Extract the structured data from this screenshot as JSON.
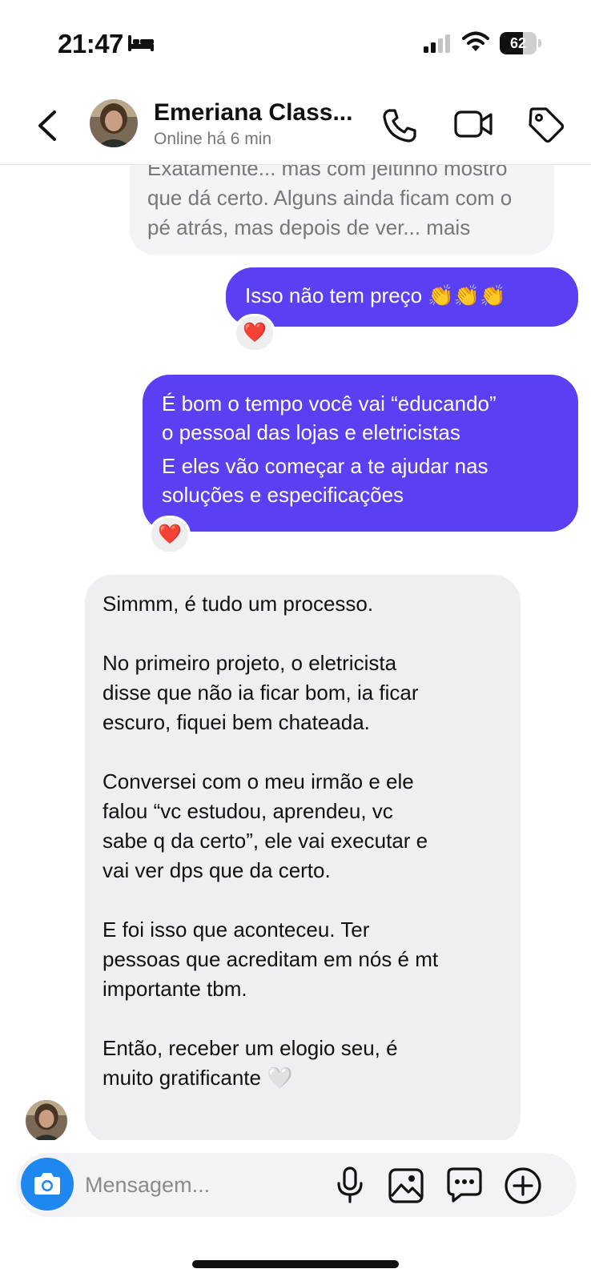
{
  "status_bar": {
    "time": "21:47",
    "battery": "62",
    "battery_level": 0.62,
    "icons": [
      "bed-icon",
      "signal-icon",
      "wifi-icon",
      "battery-icon"
    ]
  },
  "header": {
    "contact_name": "Emeriana Class...",
    "contact_status": "Online há 6 min",
    "icons": [
      "back-icon",
      "phone-icon",
      "video-icon",
      "tag-icon"
    ]
  },
  "messages": [
    {
      "sender": "contact",
      "lines": [
        "Exatamente... mas com jeitinho mostro",
        "que dá certo. Alguns ainda ficam com o",
        "pé atrás, mas depois de ver... mais"
      ]
    },
    {
      "sender": "me",
      "text": "Isso não tem preço 👏👏👏",
      "reaction": "❤️"
    },
    {
      "sender": "me",
      "paragraphs": [
        [
          "É bom o tempo você vai “educando”",
          "o pessoal das lojas e eletricistas"
        ],
        [
          "E eles vão começar a te ajudar nas",
          "soluções e especificações"
        ]
      ],
      "reaction": "❤️"
    },
    {
      "sender": "contact",
      "paragraphs": [
        [
          "Simmm, é tudo um processo."
        ],
        [
          "No primeiro projeto, o eletricista",
          "disse que não ia ficar bom, ia ficar",
          "escuro, fiquei bem chateada."
        ],
        [
          "Conversei com o meu irmão e ele",
          "falou “vc estudou, aprendeu, vc",
          "sabe q da certo”, ele vai executar e",
          "vai ver dps que da certo."
        ],
        [
          "E foi isso que aconteceu. Ter",
          "pessoas que acreditam em nós é mt",
          "importante tbm."
        ],
        [
          "Então, receber um elogio seu, é",
          "muito gratificante 🤍"
        ]
      ]
    }
  ],
  "composer": {
    "placeholder": "Mensagem...",
    "icons": [
      "camera-icon",
      "microphone-icon",
      "gallery-icon",
      "sticker-icon",
      "plus-icon"
    ]
  },
  "colors": {
    "outgoing_bubble": "#5b3ff2",
    "incoming_bubble": "#efeff2",
    "camera_button": "#1e88f0"
  }
}
